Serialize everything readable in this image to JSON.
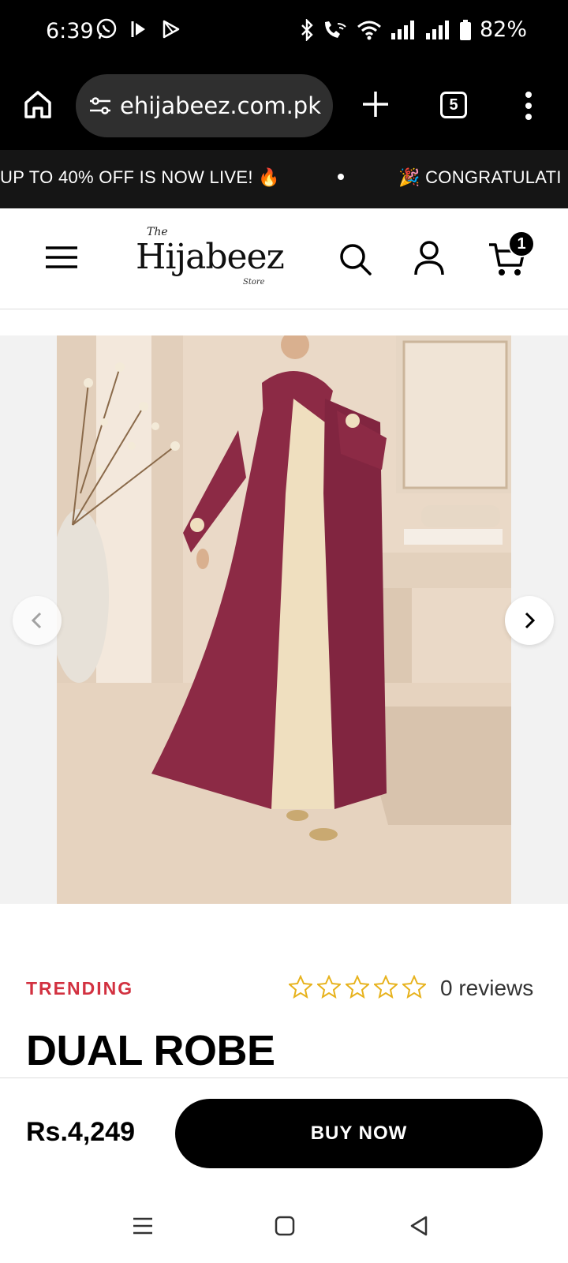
{
  "status_bar": {
    "time": "6:39",
    "battery": "82%",
    "icons": [
      "whatsapp-icon",
      "app-icon",
      "play-store-icon",
      "bluetooth-icon",
      "wifi-call-icon",
      "wifi-icon",
      "signal-icon",
      "signal-icon",
      "battery-icon"
    ]
  },
  "browser": {
    "url": "ehijabeez.com.pk",
    "tab_count": "5",
    "icons": [
      "home-icon",
      "tune-icon",
      "plus-icon",
      "more-vert-icon"
    ]
  },
  "announcement": {
    "message_1": "UP TO 40% OFF IS NOW LIVE! 🔥",
    "message_2": "🎉 CONGRATULATI"
  },
  "header": {
    "logo_the": "The",
    "logo_name": "Hijabeez",
    "logo_sub": "Store",
    "cart_count": "1",
    "icons": [
      "menu-icon",
      "search-icon",
      "account-icon",
      "cart-icon"
    ]
  },
  "product": {
    "badge": "TRENDING",
    "rating_stars": 0,
    "rating_max": 5,
    "reviews": "0 reviews",
    "title": "DUAL ROBE",
    "price": "Rs.4,249",
    "buy_label": "BUY NOW"
  },
  "colors": {
    "accent": "#d23140",
    "robe": "#8c2a45",
    "star": "#e7b21c"
  }
}
